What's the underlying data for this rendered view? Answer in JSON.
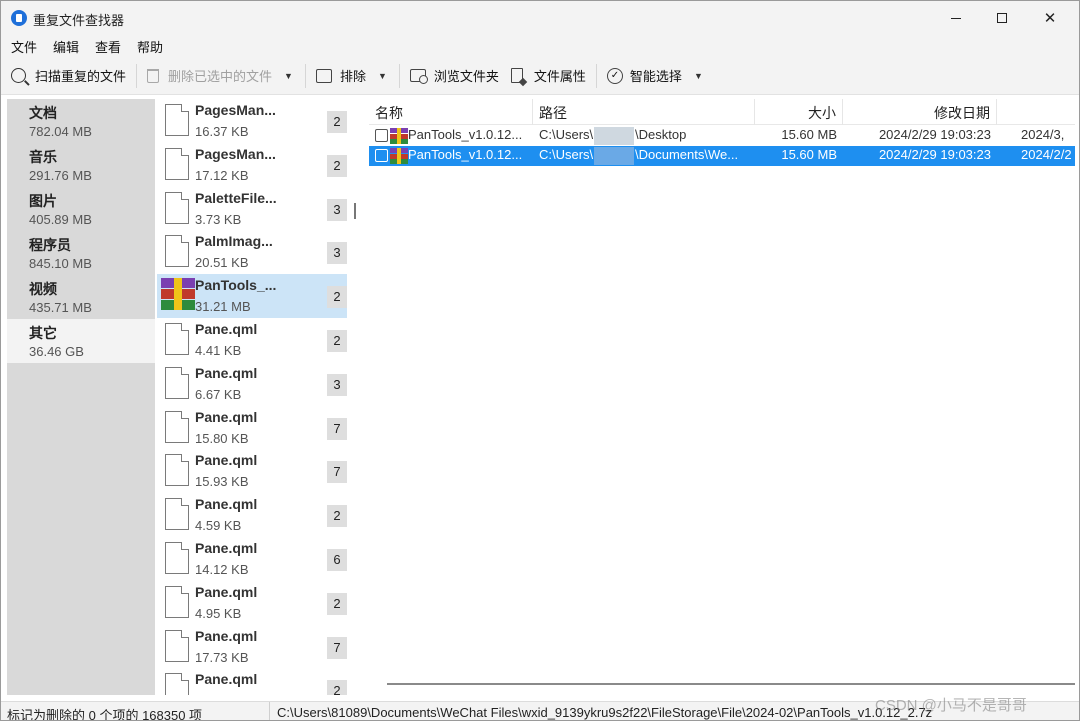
{
  "window": {
    "title": "重复文件查找器"
  },
  "menu": [
    "文件",
    "编辑",
    "查看",
    "帮助"
  ],
  "toolbar": {
    "scan": "扫描重复的文件",
    "delete_selected": "删除已选中的文件",
    "exclude": "排除",
    "browse_folder": "浏览文件夹",
    "file_properties": "文件属性",
    "smart_select": "智能选择"
  },
  "categories": [
    {
      "name": "文档",
      "size": "782.04 MB"
    },
    {
      "name": "音乐",
      "size": "291.76 MB"
    },
    {
      "name": "图片",
      "size": "405.89 MB"
    },
    {
      "name": "程序员",
      "size": "845.10 MB"
    },
    {
      "name": "视频",
      "size": "435.71 MB"
    },
    {
      "name": "其它",
      "size": "36.46 GB"
    }
  ],
  "groups": [
    {
      "name": "PagesMan...",
      "size": "16.37 KB",
      "count": "2"
    },
    {
      "name": "PagesMan...",
      "size": "17.12 KB",
      "count": "2"
    },
    {
      "name": "PaletteFile...",
      "size": "3.73 KB",
      "count": "3"
    },
    {
      "name": "PalmImag...",
      "size": "20.51 KB",
      "count": "3"
    },
    {
      "name": "PanTools_...",
      "size": "31.21 MB",
      "count": "2"
    },
    {
      "name": "Pane.qml",
      "size": "4.41 KB",
      "count": "2"
    },
    {
      "name": "Pane.qml",
      "size": "6.67 KB",
      "count": "3"
    },
    {
      "name": "Pane.qml",
      "size": "15.80 KB",
      "count": "7"
    },
    {
      "name": "Pane.qml",
      "size": "15.93 KB",
      "count": "7"
    },
    {
      "name": "Pane.qml",
      "size": "4.59 KB",
      "count": "2"
    },
    {
      "name": "Pane.qml",
      "size": "14.12 KB",
      "count": "6"
    },
    {
      "name": "Pane.qml",
      "size": "4.95 KB",
      "count": "2"
    },
    {
      "name": "Pane.qml",
      "size": "17.73 KB",
      "count": "7"
    },
    {
      "name": "Pane.qml",
      "size": "",
      "count": "2"
    }
  ],
  "details": {
    "columns": {
      "name": "名称",
      "path": "路径",
      "size": "大小",
      "modified": "修改日期"
    },
    "rows": [
      {
        "name": "PanTools_v1.0.12...",
        "path_a": "C:\\Users\\",
        "path_b": "\\Desktop",
        "size": "15.60 MB",
        "modified": "2024/2/29 19:03:23",
        "extra": "2024/3,"
      },
      {
        "name": "PanTools_v1.0.12...",
        "path_a": "C:\\Users\\",
        "path_b": "\\Documents\\We...",
        "size": "15.60 MB",
        "modified": "2024/2/29 19:03:23",
        "extra": "2024/2/2"
      }
    ]
  },
  "status": {
    "summary": "标记为删除的 0 个项的 168350 项",
    "path": "C:\\Users\\81089\\Documents\\WeChat Files\\wxid_9139ykru9s2f22\\FileStorage\\File\\2024-02\\PanTools_v1.0.12_2.7z"
  },
  "watermark": "CSDN @小马不是哥哥"
}
